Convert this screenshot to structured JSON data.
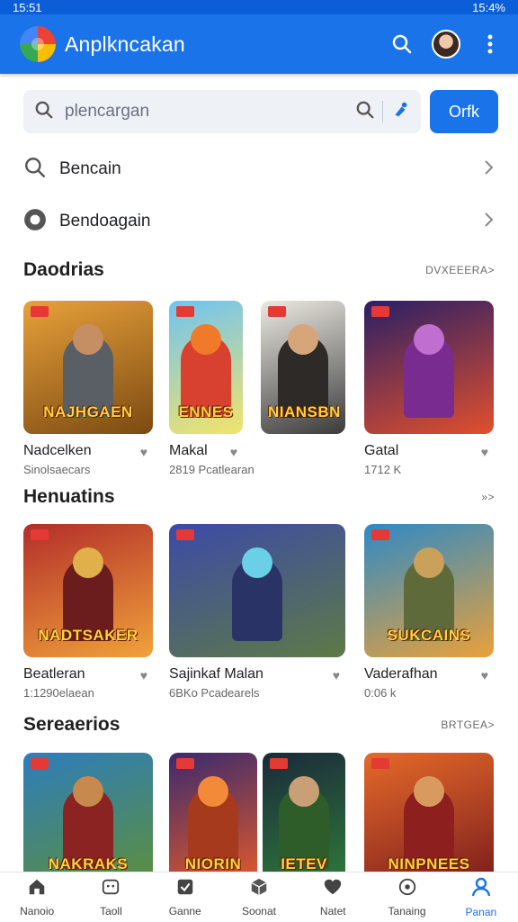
{
  "status": {
    "time": "15:51",
    "battery": "15:4%"
  },
  "appbar": {
    "title": "Anplkncakan",
    "icons": [
      "search-icon",
      "avatar",
      "more-vert-icon"
    ]
  },
  "search": {
    "placeholder": "plencargan",
    "button_label": "Orfk"
  },
  "quick_links": [
    {
      "label": "Bencain",
      "icon": "search-icon"
    },
    {
      "label": "Bendoagain",
      "icon": "record-icon"
    }
  ],
  "sections": [
    {
      "title": "Daodrias",
      "more": "DVXEEERA>",
      "cards": [
        {
          "name": "Nadcelken",
          "meta": "Sinolsaecars",
          "banner": "NAJHGAEN",
          "c1": "#e8a13a",
          "c2": "#7b4a12",
          "fig": "#5a5f66",
          "head": "#c58e63"
        },
        {
          "name": "Makal",
          "meta": "2819  Pcatlearan",
          "banner": "ENNES",
          "c1": "#6fc3f2",
          "c2": "#f2e46a",
          "fig": "#d8412f",
          "head": "#f07a2a"
        },
        {
          "name": "",
          "meta": "",
          "banner": "NIANSBN",
          "c1": "#ece9e2",
          "c2": "#3b3b3b",
          "fig": "#2e2a27",
          "head": "#d6a57a"
        },
        {
          "name": "Gatal",
          "meta": "1712  K",
          "banner": "",
          "c1": "#2a1f66",
          "c2": "#e14f2d",
          "fig": "#7a2b8f",
          "head": "#c06fd0"
        }
      ]
    },
    {
      "title": "Henuatins",
      "more": "»>",
      "cards": [
        {
          "name": "Beatleran",
          "meta": "1:1290elaean",
          "banner": "NADTSAKER",
          "c1": "#b32e2a",
          "c2": "#f0a23a",
          "fig": "#6b1c1c",
          "head": "#e0b14a"
        },
        {
          "name": "Sajinkaf Malan",
          "meta": "6BKo Pcadearels",
          "banner": "",
          "c1": "#3c4aa8",
          "c2": "#5d7a46",
          "fig": "#2a3366",
          "head": "#6ad0e8"
        },
        {
          "name": "Vaderafhan",
          "meta": "0:06 k",
          "banner": "SUKCAINS",
          "c1": "#2e8ac6",
          "c2": "#e9a13a",
          "fig": "#5f6a3a",
          "head": "#c9a15a"
        }
      ]
    },
    {
      "title": "Sereaerios",
      "more": "BRTGEA>",
      "cards": [
        {
          "name": "",
          "meta": "",
          "banner": "NAKRAKS",
          "c1": "#2d7dbd",
          "c2": "#5d8f3a",
          "fig": "#8b2323",
          "head": "#c8894f"
        },
        {
          "name": "",
          "meta": "",
          "banner": "NIORIN",
          "c1": "#3a2a6e",
          "c2": "#e45a2a",
          "fig": "#a53a1c",
          "head": "#f28a3a"
        },
        {
          "name": "",
          "meta": "",
          "banner": "IETEV",
          "c1": "#1a2a3a",
          "c2": "#2f7a3a",
          "fig": "#2f5d2a",
          "head": "#c9a075"
        },
        {
          "name": "",
          "meta": "",
          "banner": "NINPNEES",
          "c1": "#e56a2a",
          "c2": "#7a1c1c",
          "fig": "#8e1f1f",
          "head": "#d99a60"
        }
      ]
    }
  ],
  "bottom_nav": [
    {
      "label": "Nanoio",
      "icon": "home-icon"
    },
    {
      "label": "Taoll",
      "icon": "game-controller-icon"
    },
    {
      "label": "Ganne",
      "icon": "check-square-icon"
    },
    {
      "label": "Soonat",
      "icon": "cube-icon"
    },
    {
      "label": "Natet",
      "icon": "chat-icon"
    },
    {
      "label": "Tanaing",
      "icon": "coin-icon"
    },
    {
      "label": "Panan",
      "icon": "person-icon",
      "active": true
    }
  ],
  "colors": {
    "primary": "#1a73e8",
    "statusbar": "#0b5ed7"
  }
}
